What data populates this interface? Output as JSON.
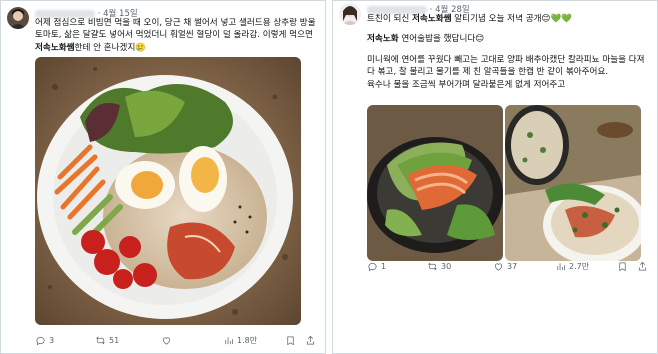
{
  "left_post": {
    "date": "4월 15일",
    "lines": [
      "어제 점심으로 비빔면 먹을 때 오이, 당근 채 썰어서 넣고 샐러드용 상추랑 방울",
      "토마토, 삶은 달걀도 넣어서 먹었더니 훠얼씬 혈당이 덜 올라감. 이렇게 먹으면",
      "한테 안 혼나겠지🥲"
    ],
    "brand": "저속노화쌤",
    "actions": {
      "reply": "3",
      "repost": "51",
      "like": "",
      "views": "1.8만"
    }
  },
  "right_post": {
    "date": "4월 28일",
    "line1_prefix": "트친이 되신 ",
    "line1_brand": "저속노화쌤",
    "line1_suffix": " 알티기념 오늘 저녁 공개😊💚💚",
    "line2_brand": "저속노화",
    "line2_rest": " 연어술밥을 했답니다😊",
    "lines": [
      "미니웍에 연어를 꾸웠다 빼고는 고대로 양파 배추아캤단 칼라피뇨 마늘을 다져",
      "다 볶고, 찰 불리고 물기를 제 친 알곡들을 한캡 반 같이 볶아주어요.",
      "",
      "육수나 물을 조금씩 부어가며 달라붙은게 없게 저어주고"
    ],
    "actions": {
      "reply": "1",
      "repost": "30",
      "like": "37",
      "views": "2.7만"
    }
  },
  "colors": {
    "text": "#0f1419",
    "muted": "#536471",
    "border": "#cfd9de",
    "like": "#536471"
  }
}
